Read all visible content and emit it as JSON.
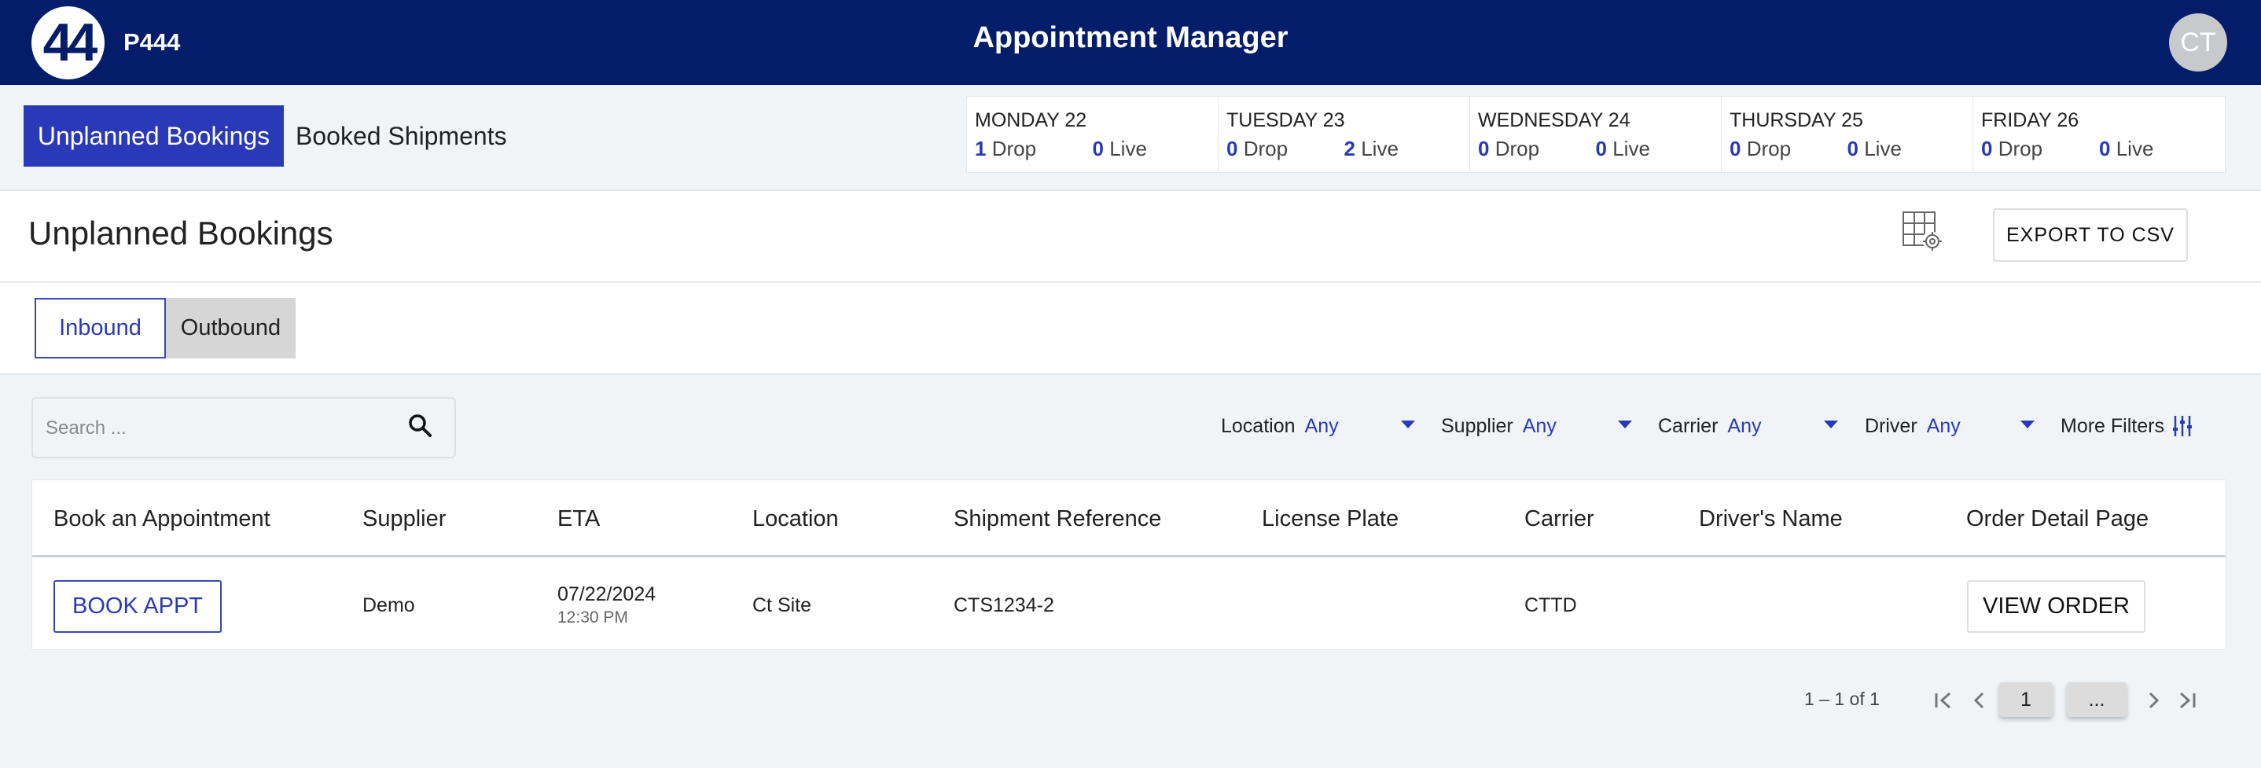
{
  "header": {
    "logo_text": "44",
    "org_code": "P444",
    "app_title": "Appointment Manager",
    "user_initials": "CT"
  },
  "tabs": {
    "unplanned": "Unplanned Bookings",
    "booked": "Booked Shipments"
  },
  "summary": [
    {
      "day": "MONDAY 22",
      "drop": "1",
      "drop_label": "Drop",
      "live": "0",
      "live_label": "Live"
    },
    {
      "day": "TUESDAY 23",
      "drop": "0",
      "drop_label": "Drop",
      "live": "2",
      "live_label": "Live"
    },
    {
      "day": "WEDNESDAY 24",
      "drop": "0",
      "drop_label": "Drop",
      "live": "0",
      "live_label": "Live"
    },
    {
      "day": "THURSDAY 25",
      "drop": "0",
      "drop_label": "Drop",
      "live": "0",
      "live_label": "Live"
    },
    {
      "day": "FRIDAY 26",
      "drop": "0",
      "drop_label": "Drop",
      "live": "0",
      "live_label": "Live"
    }
  ],
  "page": {
    "title": "Unplanned Bookings",
    "export_label": "EXPORT TO CSV"
  },
  "direction": {
    "inbound": "Inbound",
    "outbound": "Outbound"
  },
  "search": {
    "placeholder": "Search ..."
  },
  "filters": {
    "location": {
      "label": "Location",
      "value": "Any"
    },
    "supplier": {
      "label": "Supplier",
      "value": "Any"
    },
    "carrier": {
      "label": "Carrier",
      "value": "Any"
    },
    "driver": {
      "label": "Driver",
      "value": "Any"
    },
    "more": "More Filters"
  },
  "table": {
    "columns": [
      "Book an Appointment",
      "Supplier",
      "ETA",
      "Location",
      "Shipment Reference",
      "License Plate",
      "Carrier",
      "Driver's Name",
      "Order Detail Page"
    ],
    "rows": [
      {
        "book_label": "BOOK APPT",
        "supplier": "Demo",
        "eta_date": "07/22/2024",
        "eta_time": "12:30 PM",
        "location": "Ct Site",
        "shipment_reference": "CTS1234-2",
        "license_plate": "",
        "carrier": "CTTD",
        "driver_name": "",
        "view_label": "VIEW ORDER"
      }
    ]
  },
  "pagination": {
    "range": "1 – 1 of 1",
    "current_page": "1",
    "more_label": "..."
  },
  "colors": {
    "header_bg": "#031d6a",
    "accent": "#2a39b8"
  }
}
